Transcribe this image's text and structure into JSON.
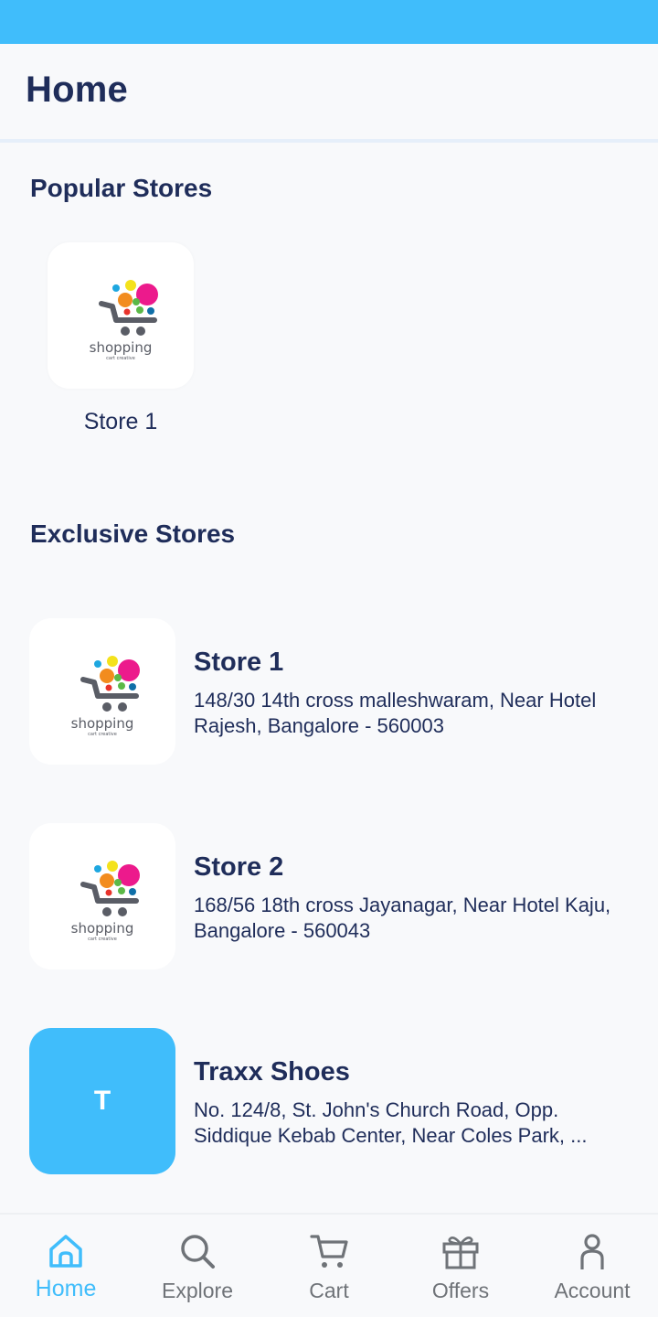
{
  "header": {
    "title": "Home"
  },
  "popular": {
    "title": "Popular Stores",
    "stores": [
      {
        "name": "Store 1",
        "logo_text": "shopping",
        "logo_tag": "cart creative"
      }
    ]
  },
  "exclusive": {
    "title": "Exclusive Stores",
    "stores": [
      {
        "name": "Store 1",
        "address": "148/30 14th cross malleshwaram, Near Hotel Rajesh, Bangalore - 560003",
        "logo_text": "shopping",
        "logo_tag": "cart creative"
      },
      {
        "name": "Store 2",
        "address": "168/56 18th cross Jayanagar, Near Hotel Kaju, Bangalore - 560043",
        "logo_text": "shopping",
        "logo_tag": "cart creative"
      },
      {
        "name": "Traxx Shoes",
        "address": "No. 124/8, St. John's Church Road, Opp. Siddique Kebab Center, Near Coles Park, ...",
        "initial": "T"
      }
    ]
  },
  "nav": {
    "items": [
      {
        "label": "Home",
        "icon": "home-icon",
        "active": true
      },
      {
        "label": "Explore",
        "icon": "search-icon"
      },
      {
        "label": "Cart",
        "icon": "cart-icon"
      },
      {
        "label": "Offers",
        "icon": "gift-icon"
      },
      {
        "label": "Account",
        "icon": "person-icon"
      }
    ]
  },
  "colors": {
    "accent": "#40bdfb",
    "text": "#1f2d5a",
    "inactive": "#6f7378"
  }
}
